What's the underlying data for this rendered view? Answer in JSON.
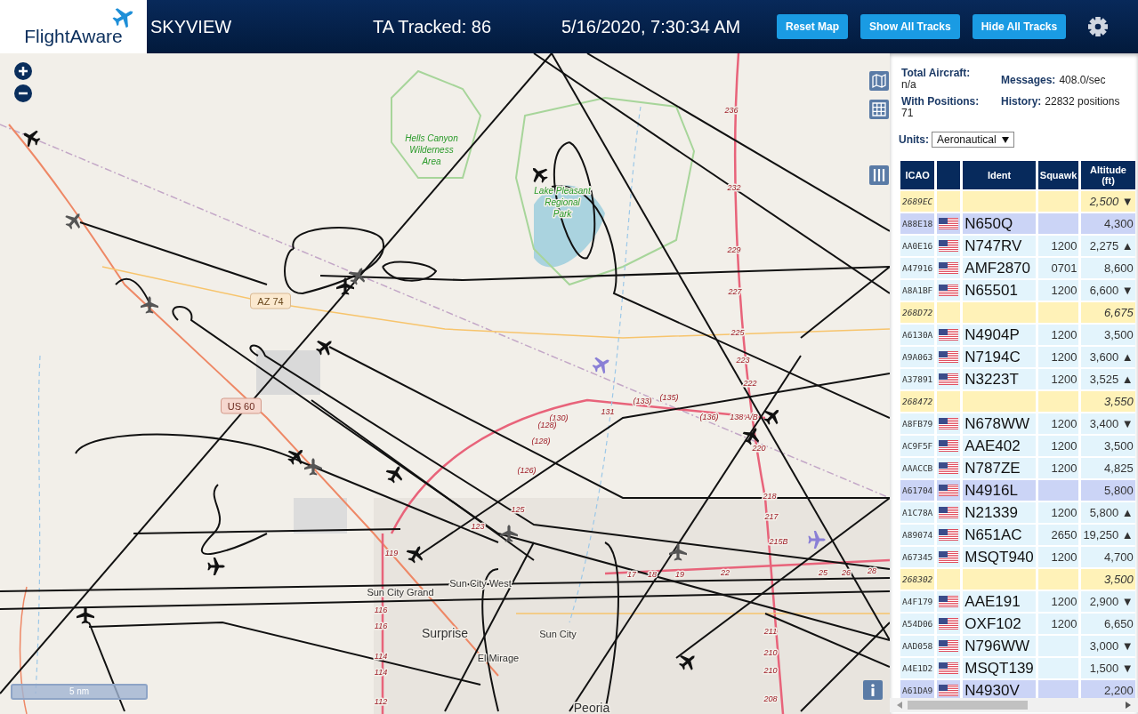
{
  "header": {
    "logo": "FlightAware",
    "title": "SKYVIEW",
    "tracked": "TA Tracked: 86",
    "datetime": "5/16/2020, 7:30:34 AM",
    "buttons": [
      "Reset Map",
      "Show All Tracks",
      "Hide All Tracks"
    ]
  },
  "stats": [
    {
      "label": "Total Aircraft:",
      "value": "n/a"
    },
    {
      "label": "Messages:",
      "value": "408.0/sec"
    },
    {
      "label": "With Positions:",
      "value": "71"
    },
    {
      "label": "History:",
      "value": "22832 positions"
    }
  ],
  "units": {
    "label": "Units:",
    "value": "Aeronautical"
  },
  "table": {
    "columns": [
      "ICAO",
      "",
      "Ident",
      "Squawk",
      "Altitude (ft)"
    ],
    "rows": [
      {
        "kind": "noident",
        "icao": "2689EC",
        "ident": "",
        "squawk": "",
        "altitude": "2,500 ▼"
      },
      {
        "kind": "highlight",
        "icao": "A88E18",
        "ident": "N650Q",
        "squawk": "",
        "altitude": "4,300"
      },
      {
        "kind": "normal",
        "icao": "AA0E16",
        "ident": "N747RV",
        "squawk": "1200",
        "altitude": "2,275 ▲"
      },
      {
        "kind": "normal",
        "icao": "A47916",
        "ident": "AMF2870",
        "squawk": "0701",
        "altitude": "8,600"
      },
      {
        "kind": "normal",
        "icao": "A8A1BF",
        "ident": "N65501",
        "squawk": "1200",
        "altitude": "6,600 ▼"
      },
      {
        "kind": "noident",
        "icao": "268D72",
        "ident": "",
        "squawk": "",
        "altitude": "6,675"
      },
      {
        "kind": "normal",
        "icao": "A6130A",
        "ident": "N4904P",
        "squawk": "1200",
        "altitude": "3,500"
      },
      {
        "kind": "normal",
        "icao": "A9A063",
        "ident": "N7194C",
        "squawk": "1200",
        "altitude": "3,600 ▲"
      },
      {
        "kind": "normal",
        "icao": "A37891",
        "ident": "N3223T",
        "squawk": "1200",
        "altitude": "3,525 ▲"
      },
      {
        "kind": "noident",
        "icao": "268472",
        "ident": "",
        "squawk": "",
        "altitude": "3,550"
      },
      {
        "kind": "normal",
        "icao": "A8FB79",
        "ident": "N678WW",
        "squawk": "1200",
        "altitude": "3,400 ▼"
      },
      {
        "kind": "normal",
        "icao": "AC9F5F",
        "ident": "AAE402",
        "squawk": "1200",
        "altitude": "3,500"
      },
      {
        "kind": "normal",
        "icao": "AAACCB",
        "ident": "N787ZE",
        "squawk": "1200",
        "altitude": "4,825"
      },
      {
        "kind": "highlight",
        "icao": "A61704",
        "ident": "N4916L",
        "squawk": "",
        "altitude": "5,800"
      },
      {
        "kind": "normal",
        "icao": "A1C78A",
        "ident": "N21339",
        "squawk": "1200",
        "altitude": "5,800 ▲"
      },
      {
        "kind": "normal",
        "icao": "A89074",
        "ident": "N651AC",
        "squawk": "2650",
        "altitude": "19,250 ▲"
      },
      {
        "kind": "normal",
        "icao": "A67345",
        "ident": "MSQT940",
        "squawk": "1200",
        "altitude": "4,700"
      },
      {
        "kind": "noident",
        "icao": "268302",
        "ident": "",
        "squawk": "",
        "altitude": "3,500"
      },
      {
        "kind": "normal",
        "icao": "A4F179",
        "ident": "AAE191",
        "squawk": "1200",
        "altitude": "2,900 ▼"
      },
      {
        "kind": "normal",
        "icao": "A54D06",
        "ident": "OXF102",
        "squawk": "1200",
        "altitude": "6,650"
      },
      {
        "kind": "normal",
        "icao": "AAD058",
        "ident": "N796WW",
        "squawk": "",
        "altitude": "3,000 ▼"
      },
      {
        "kind": "normal",
        "icao": "A4E1D2",
        "ident": "MSQT139",
        "squawk": "",
        "altitude": "1,500 ▼"
      },
      {
        "kind": "highlight",
        "icao": "A61DA9",
        "ident": "N4930V",
        "squawk": "",
        "altitude": "2,200"
      }
    ]
  },
  "map": {
    "scale": "5 nm",
    "labels": [
      {
        "kind": "park",
        "lines": [
          "Hells Canyon",
          "Wilderness",
          "Area"
        ]
      },
      {
        "kind": "park",
        "lines": [
          "Lake Pleasant",
          "Regional",
          "Park"
        ]
      },
      {
        "kind": "shield",
        "lines": [
          "AZ 74"
        ]
      },
      {
        "kind": "shield-us",
        "lines": [
          "US 60"
        ]
      },
      {
        "kind": "town",
        "lines": [
          "Sun City Grand"
        ]
      },
      {
        "kind": "town",
        "lines": [
          "Sun City West"
        ]
      },
      {
        "kind": "city",
        "lines": [
          "Surprise"
        ]
      },
      {
        "kind": "town",
        "lines": [
          "Sun City"
        ]
      },
      {
        "kind": "town",
        "lines": [
          "El Mirage"
        ]
      },
      {
        "kind": "city",
        "lines": [
          "Peoria"
        ]
      },
      {
        "kind": "milepost",
        "lines": [
          "236"
        ]
      },
      {
        "kind": "milepost",
        "lines": [
          "232"
        ]
      },
      {
        "kind": "milepost",
        "lines": [
          "229"
        ]
      },
      {
        "kind": "milepost",
        "lines": [
          "227"
        ]
      },
      {
        "kind": "milepost",
        "lines": [
          "225"
        ]
      },
      {
        "kind": "milepost",
        "lines": [
          "223"
        ]
      },
      {
        "kind": "milepost",
        "lines": [
          "222"
        ]
      },
      {
        "kind": "milepost",
        "lines": [
          "220"
        ]
      },
      {
        "kind": "milepost",
        "lines": [
          "218"
        ]
      },
      {
        "kind": "milepost",
        "lines": [
          "217"
        ]
      },
      {
        "kind": "milepost",
        "lines": [
          "215B"
        ]
      },
      {
        "kind": "milepost",
        "lines": [
          "211"
        ]
      },
      {
        "kind": "milepost",
        "lines": [
          "210"
        ]
      },
      {
        "kind": "milepost",
        "lines": [
          "210"
        ]
      },
      {
        "kind": "milepost",
        "lines": [
          "208"
        ]
      },
      {
        "kind": "milepost",
        "lines": [
          "(130)"
        ]
      },
      {
        "kind": "milepost",
        "lines": [
          "131"
        ]
      },
      {
        "kind": "milepost",
        "lines": [
          "(133)"
        ]
      },
      {
        "kind": "milepost",
        "lines": [
          "(135)"
        ]
      },
      {
        "kind": "milepost",
        "lines": [
          "(136)"
        ]
      },
      {
        "kind": "milepost",
        "lines": [
          "138 A/B"
        ]
      },
      {
        "kind": "milepost",
        "lines": [
          "(128)"
        ]
      },
      {
        "kind": "milepost",
        "lines": [
          "(128)"
        ]
      },
      {
        "kind": "milepost",
        "lines": [
          "(126)"
        ]
      },
      {
        "kind": "milepost",
        "lines": [
          "125"
        ]
      },
      {
        "kind": "milepost",
        "lines": [
          "123"
        ]
      },
      {
        "kind": "milepost",
        "lines": [
          "119"
        ]
      },
      {
        "kind": "milepost",
        "lines": [
          "116"
        ]
      },
      {
        "kind": "milepost",
        "lines": [
          "116"
        ]
      },
      {
        "kind": "milepost",
        "lines": [
          "114"
        ]
      },
      {
        "kind": "milepost",
        "lines": [
          "114"
        ]
      },
      {
        "kind": "milepost",
        "lines": [
          "112"
        ]
      },
      {
        "kind": "milepost",
        "lines": [
          "17"
        ]
      },
      {
        "kind": "milepost",
        "lines": [
          "18"
        ]
      },
      {
        "kind": "milepost",
        "lines": [
          "19"
        ]
      },
      {
        "kind": "milepost",
        "lines": [
          "22"
        ]
      },
      {
        "kind": "milepost",
        "lines": [
          "25"
        ]
      },
      {
        "kind": "milepost",
        "lines": [
          "26"
        ]
      },
      {
        "kind": "milepost",
        "lines": [
          "28"
        ]
      }
    ]
  }
}
